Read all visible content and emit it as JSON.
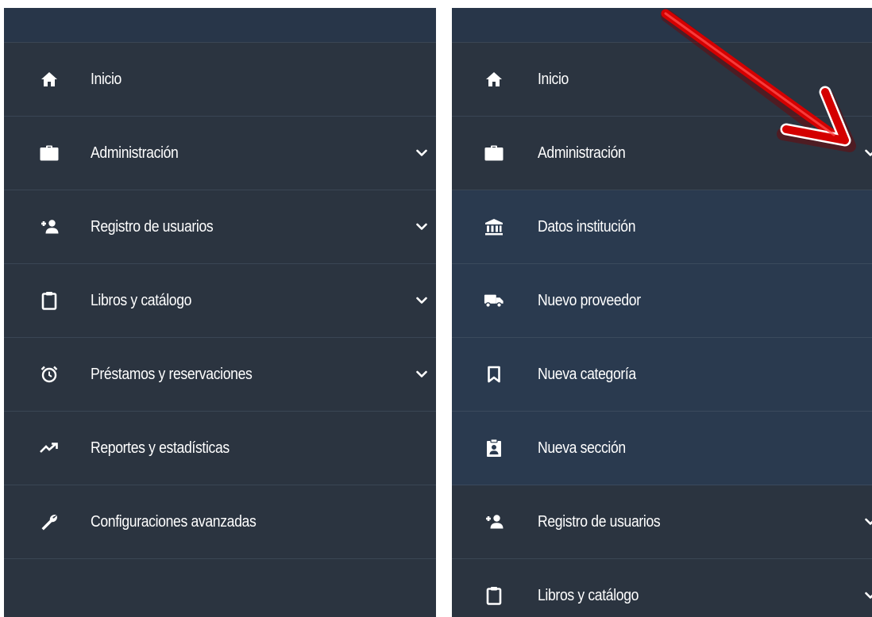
{
  "left_menu": {
    "items": [
      {
        "label": "Inicio",
        "icon": "home-icon"
      },
      {
        "label": "Administración",
        "icon": "briefcase-icon",
        "chevron": true
      },
      {
        "label": "Registro de usuarios",
        "icon": "add-user-icon",
        "chevron": true
      },
      {
        "label": "Libros y catálogo",
        "icon": "clipboard-icon",
        "chevron": true
      },
      {
        "label": "Préstamos y reservaciones",
        "icon": "alarm-clock-icon",
        "chevron": true
      },
      {
        "label": "Reportes y estadísticas",
        "icon": "trending-up-icon"
      },
      {
        "label": "Configuraciones avanzadas",
        "icon": "wrench-icon"
      }
    ]
  },
  "right_menu": {
    "items": [
      {
        "label": "Inicio",
        "icon": "home-icon"
      },
      {
        "label": "Administración",
        "icon": "briefcase-icon",
        "chevron": true,
        "expanded": true
      },
      {
        "label": "Registro de usuarios",
        "icon": "add-user-icon",
        "chevron": true
      },
      {
        "label": "Libros y catálogo",
        "icon": "clipboard-icon",
        "chevron": true
      }
    ],
    "submenu": [
      {
        "label": "Datos institución",
        "icon": "bank-icon"
      },
      {
        "label": "Nuevo proveedor",
        "icon": "truck-icon"
      },
      {
        "label": "Nueva categoría",
        "icon": "bookmark-icon"
      },
      {
        "label": "Nueva sección",
        "icon": "badge-icon"
      }
    ]
  },
  "colors": {
    "sidebar_bg": "#2b3440",
    "submenu_bg": "#2a3a4f",
    "header_bg": "#283649",
    "divider": "#3a4654",
    "text": "#ffffff",
    "annotation_arrow": "#d40000"
  }
}
